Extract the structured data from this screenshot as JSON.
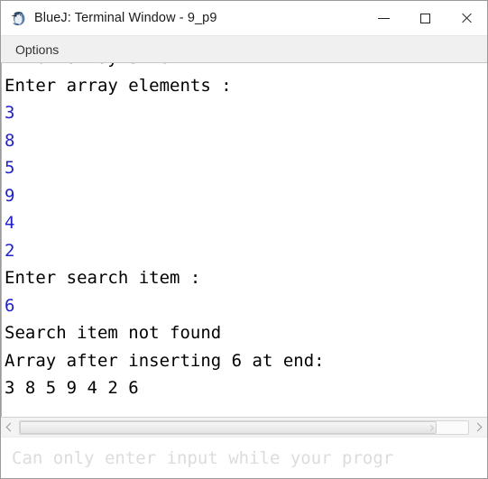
{
  "window": {
    "title": "BlueJ: Terminal Window - 9_p9",
    "app_icon": "bluej-penguin-icon",
    "controls": {
      "minimize_label": "Minimize",
      "maximize_label": "Maximize",
      "close_label": "Close"
    }
  },
  "menubar": {
    "items": [
      {
        "label": "Options"
      }
    ]
  },
  "terminal": {
    "lines": [
      {
        "text": "Enter array size :",
        "kind": "output",
        "clipped_top": true
      },
      {
        "text": "Enter array elements :",
        "kind": "output"
      },
      {
        "text": "3",
        "kind": "input"
      },
      {
        "text": "8",
        "kind": "input"
      },
      {
        "text": "5",
        "kind": "input"
      },
      {
        "text": "9",
        "kind": "input"
      },
      {
        "text": "4",
        "kind": "input"
      },
      {
        "text": "2",
        "kind": "input"
      },
      {
        "text": "Enter search item :",
        "kind": "output"
      },
      {
        "text": "6",
        "kind": "input"
      },
      {
        "text": "Search item not found",
        "kind": "output"
      },
      {
        "text": "Array after inserting 6 at end:",
        "kind": "output"
      },
      {
        "text": "3 8 5 9 4 2 6",
        "kind": "output"
      }
    ],
    "output_color": "#000000",
    "input_color": "#2222cc"
  },
  "scrollbar": {
    "left_arrow_icon": "chevron-left-icon",
    "right_arrow_icon": "chevron-right-icon",
    "thumb_width_percent": 93
  },
  "status": {
    "text": "Can only enter input while your progr",
    "color": "#dcdcdc"
  }
}
